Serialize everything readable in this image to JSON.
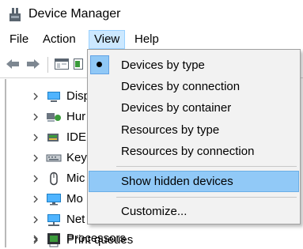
{
  "window": {
    "title": "Device Manager",
    "icon": "device-manager-icon"
  },
  "menubar": {
    "items": [
      {
        "label": "File"
      },
      {
        "label": "Action"
      },
      {
        "label": "View"
      },
      {
        "label": "Help"
      }
    ],
    "open_item": "View"
  },
  "toolbar": {
    "buttons": [
      "back-arrow-icon",
      "forward-arrow-icon",
      "properties-icon",
      "update-driver-icon"
    ]
  },
  "tree": {
    "items": [
      {
        "label": "Disp",
        "icon": "display-adapter-icon"
      },
      {
        "label": "Hur",
        "icon": "human-interface-device-icon"
      },
      {
        "label": "IDE",
        "icon": "ide-controller-icon"
      },
      {
        "label": "Key",
        "icon": "keyboard-icon"
      },
      {
        "label": "Mic",
        "icon": "mouse-icon"
      },
      {
        "label": "Mo",
        "icon": "monitor-icon"
      },
      {
        "label": "Net",
        "icon": "network-adapter-icon"
      },
      {
        "label": "Print queues",
        "icon": "printer-icon"
      },
      {
        "label": "Processors",
        "icon": "processor-icon"
      }
    ]
  },
  "view_menu": {
    "items": [
      {
        "label": "Devices by type",
        "checked": true
      },
      {
        "label": "Devices by connection"
      },
      {
        "label": "Devices by container"
      },
      {
        "label": "Resources by type"
      },
      {
        "label": "Resources by connection"
      },
      {
        "label": "Show hidden devices",
        "highlighted": true
      },
      {
        "label": "Customize..."
      }
    ]
  },
  "colors": {
    "menu_highlight": "#91c9f7",
    "menu_open_bg": "#cce8ff",
    "menu_bg": "#f2f2f2"
  }
}
